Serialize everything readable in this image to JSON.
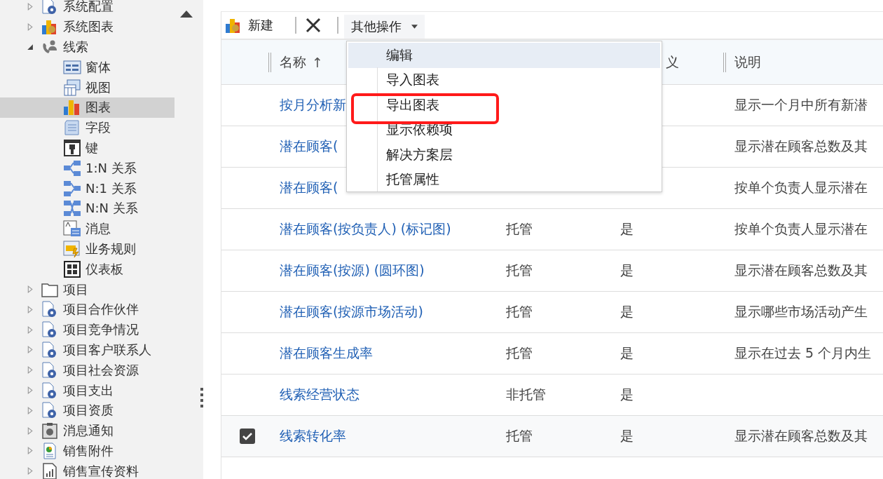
{
  "sidebar": {
    "items": [
      {
        "label": "系统配置",
        "kind": "entity",
        "expanded": false,
        "selected": false
      },
      {
        "label": "系统图表",
        "kind": "chart-set",
        "expanded": false,
        "selected": false
      },
      {
        "label": "线索",
        "kind": "contact",
        "expanded": true,
        "selected": false,
        "children": [
          {
            "label": "窗体",
            "kind": "form",
            "selected": false
          },
          {
            "label": "视图",
            "kind": "view",
            "selected": false
          },
          {
            "label": "图表",
            "kind": "chart",
            "selected": true
          },
          {
            "label": "字段",
            "kind": "field",
            "selected": false
          },
          {
            "label": "键",
            "kind": "key",
            "selected": false
          },
          {
            "label": "1:N 关系",
            "kind": "rel-1n",
            "selected": false
          },
          {
            "label": "N:1 关系",
            "kind": "rel-n1",
            "selected": false
          },
          {
            "label": "N:N 关系",
            "kind": "rel-nn",
            "selected": false
          },
          {
            "label": "消息",
            "kind": "message",
            "selected": false
          },
          {
            "label": "业务规则",
            "kind": "rule",
            "selected": false
          },
          {
            "label": "仪表板",
            "kind": "dashboard",
            "selected": false
          }
        ]
      },
      {
        "label": "项目",
        "kind": "folder",
        "expanded": false,
        "selected": false
      },
      {
        "label": "项目合作伙伴",
        "kind": "entity",
        "expanded": false,
        "selected": false
      },
      {
        "label": "项目竞争情况",
        "kind": "entity",
        "expanded": false,
        "selected": false
      },
      {
        "label": "项目客户联系人",
        "kind": "entity",
        "expanded": false,
        "selected": false
      },
      {
        "label": "项目社会资源",
        "kind": "entity",
        "expanded": false,
        "selected": false
      },
      {
        "label": "项目支出",
        "kind": "entity",
        "expanded": false,
        "selected": false
      },
      {
        "label": "项目资质",
        "kind": "entity",
        "expanded": false,
        "selected": false
      },
      {
        "label": "消息通知",
        "kind": "clipboard",
        "expanded": false,
        "selected": false
      },
      {
        "label": "销售附件",
        "kind": "attachment",
        "expanded": false,
        "selected": false
      },
      {
        "label": "销售宣传资料",
        "kind": "report",
        "expanded": false,
        "selected": false
      }
    ]
  },
  "toolbar": {
    "new_button": "新建",
    "more_button": "其他操作"
  },
  "menu": {
    "items": [
      {
        "label": "编辑",
        "selected": true,
        "annotated": false
      },
      {
        "label": "导入图表",
        "selected": false,
        "annotated": false
      },
      {
        "label": "导出图表",
        "selected": false,
        "annotated": true
      },
      {
        "label": "显示依赖项",
        "selected": false,
        "annotated": false
      },
      {
        "label": "解决方案层",
        "selected": false,
        "annotated": false
      },
      {
        "label": "托管属性",
        "selected": false,
        "annotated": false
      }
    ]
  },
  "table": {
    "header": {
      "name": "名称",
      "sort_arrow": "↑",
      "column_3": "义",
      "description": "说明"
    },
    "rows": [
      {
        "name": "按月分析新",
        "description": "显示一个月中所有新潜",
        "checked": false
      },
      {
        "name": "潜在顾客(",
        "description": "显示潜在顾客总数及其",
        "checked": false
      },
      {
        "name": "潜在顾客(",
        "description": "按单个负责人显示潜在",
        "checked": false
      },
      {
        "name": "潜在顾客(按负责人) (标记图)",
        "type": "托管",
        "column_3": "是",
        "description": "按单个负责人显示潜在",
        "checked": false
      },
      {
        "name": "潜在顾客(按源) (圆环图)",
        "type": "托管",
        "column_3": "是",
        "description": "显示潜在顾客总数及其",
        "checked": false
      },
      {
        "name": "潜在顾客(按源市场活动)",
        "type": "托管",
        "column_3": "是",
        "description": "显示哪些市场活动产生",
        "checked": false
      },
      {
        "name": "潜在顾客生成率",
        "type": "托管",
        "column_3": "是",
        "description": "显示在过去 5 个月内生",
        "checked": false
      },
      {
        "name": "线索经营状态",
        "type": "非托管",
        "column_3": "是",
        "checked": false
      },
      {
        "name": "线索转化率",
        "type": "托管",
        "column_3": "是",
        "description": "显示潜在顾客总数及其",
        "checked": true
      }
    ]
  }
}
